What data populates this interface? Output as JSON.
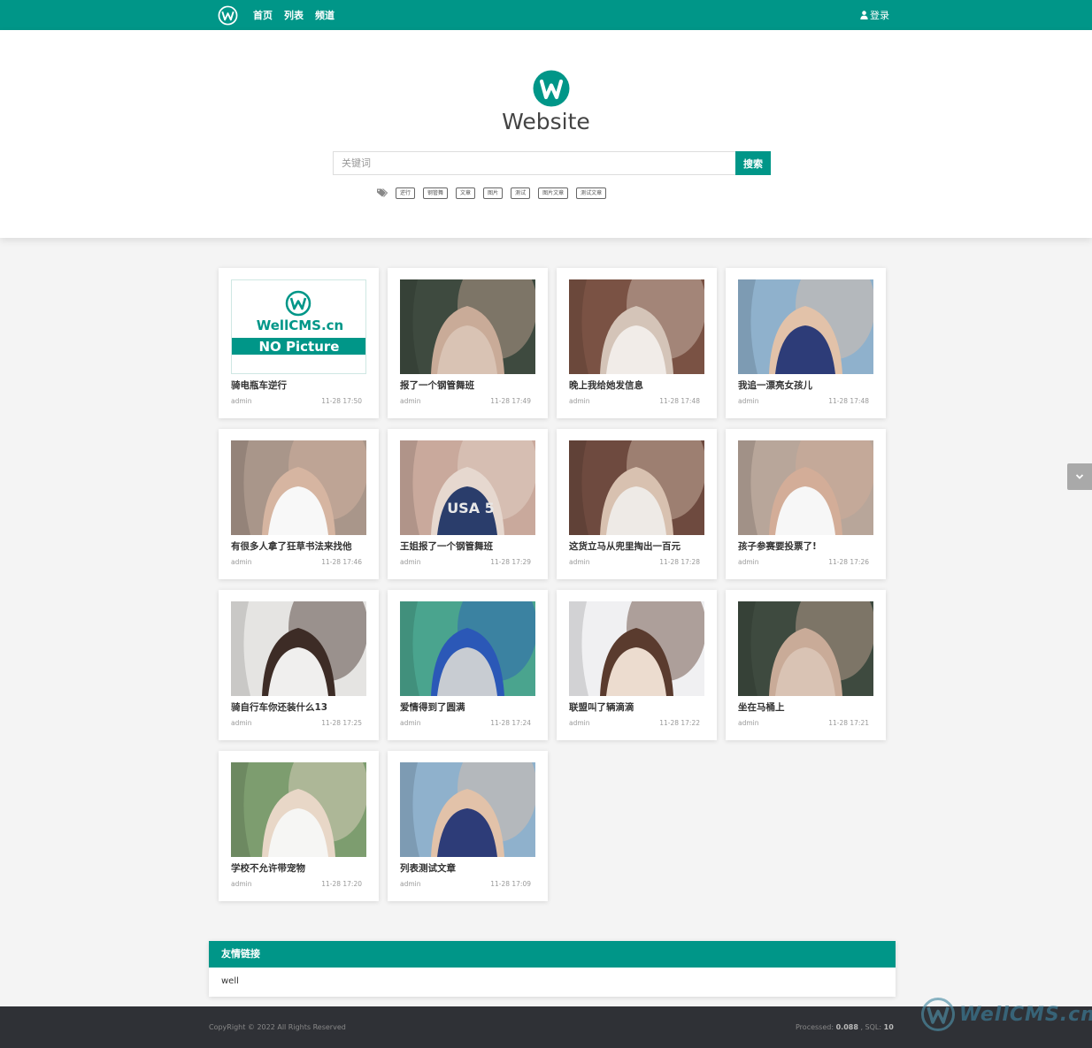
{
  "nav": {
    "logo": "wellcms-logo-icon",
    "items": [
      {
        "label": "首页"
      },
      {
        "label": "列表"
      },
      {
        "label": "频道"
      }
    ],
    "login": "登录"
  },
  "header": {
    "site_name": "Website",
    "search_placeholder": "关键词",
    "search_button": "搜索",
    "tags": [
      "逆行",
      "钢管舞",
      "文章",
      "图片",
      "测试",
      "图片文章",
      "测试文章"
    ]
  },
  "posts": [
    {
      "title": "骑电瓶车逆行",
      "author": "admin",
      "time": "11-28 17:50",
      "image": "no-picture",
      "placeholder_brand": "WellCMS.cn",
      "placeholder_text": "NO Picture"
    },
    {
      "title": "报了一个钢管舞班",
      "author": "admin",
      "time": "11-28 17:49",
      "image": "photo"
    },
    {
      "title": "晚上我给她发信息",
      "author": "admin",
      "time": "11-28 17:48",
      "image": "photo"
    },
    {
      "title": "我追一漂亮女孩儿",
      "author": "admin",
      "time": "11-28 17:48",
      "image": "photo"
    },
    {
      "title": "有很多人拿了狂草书法来找他",
      "author": "admin",
      "time": "11-28 17:46",
      "image": "photo"
    },
    {
      "title": "王姐报了一个钢管舞班",
      "author": "admin",
      "time": "11-28 17:29",
      "image": "photo",
      "shirt_text": "USA 5"
    },
    {
      "title": "这货立马从兜里掏出一百元",
      "author": "admin",
      "time": "11-28 17:28",
      "image": "photo"
    },
    {
      "title": "孩子参赛要投票了!",
      "author": "admin",
      "time": "11-28 17:26",
      "image": "photo"
    },
    {
      "title": "骑自行车你还装什么13",
      "author": "admin",
      "time": "11-28 17:25",
      "image": "photo"
    },
    {
      "title": "爱情得到了圆满",
      "author": "admin",
      "time": "11-28 17:24",
      "image": "photo"
    },
    {
      "title": "联盟叫了辆滴滴",
      "author": "admin",
      "time": "11-28 17:22",
      "image": "photo"
    },
    {
      "title": "坐在马桶上",
      "author": "admin",
      "time": "11-28 17:21",
      "image": "photo"
    },
    {
      "title": "学校不允许带宠物",
      "author": "admin",
      "time": "11-28 17:20",
      "image": "photo"
    },
    {
      "title": "列表测试文章",
      "author": "admin",
      "time": "11-28 17:09",
      "image": "photo"
    }
  ],
  "friend_links": {
    "title": "友情链接",
    "items": [
      {
        "label": "well"
      }
    ]
  },
  "footer": {
    "copyright": "CopyRight © 2022 All Rights Reserved",
    "processed_label": "Processed:",
    "processed_value": "0.088",
    "sql_label": ", SQL:",
    "sql_value": "10"
  },
  "watermark": "WellCMS.cn",
  "colors": {
    "accent": "#009688",
    "footer_bg": "#2f3136",
    "page_bg": "#f4f4f4"
  }
}
